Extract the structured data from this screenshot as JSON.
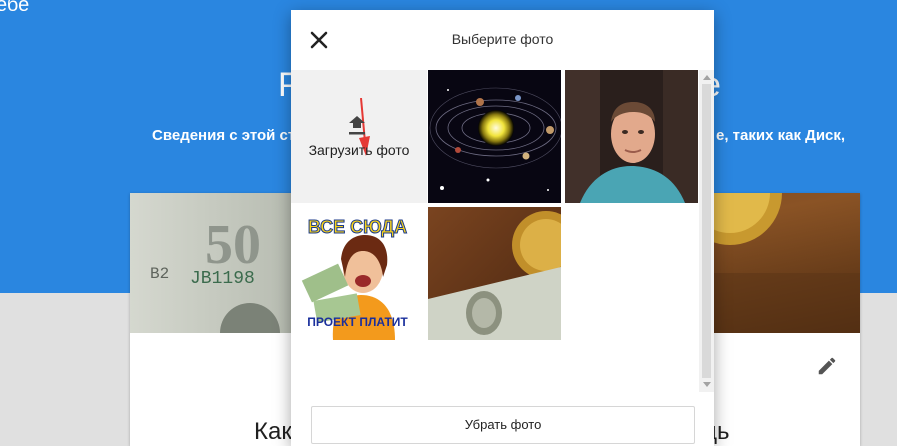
{
  "background": {
    "top_left_text": "ебе",
    "heading_left": "Р",
    "heading_right": "е",
    "description_left": "Сведения с этой ст",
    "description_right": "е, таких как Диск,",
    "card_title_left": "Как",
    "card_title_right": "дь",
    "colors": {
      "blue": "#2a86e0",
      "gray": "#e0e0e0"
    }
  },
  "dialog": {
    "title": "Выберите фото",
    "close_icon": "close-icon",
    "upload_label": "Загрузить фото",
    "upload_icon": "upload-icon",
    "remove_button": "Убрать фото",
    "photos": [
      {
        "name": "photo-solar-system"
      },
      {
        "name": "photo-portrait"
      },
      {
        "name": "photo-promo",
        "text_top": "ВСЕ СЮДА",
        "text_bottom": "ПРОЕКТ ПЛАТИТ"
      },
      {
        "name": "photo-coin-and-dollar"
      }
    ]
  }
}
